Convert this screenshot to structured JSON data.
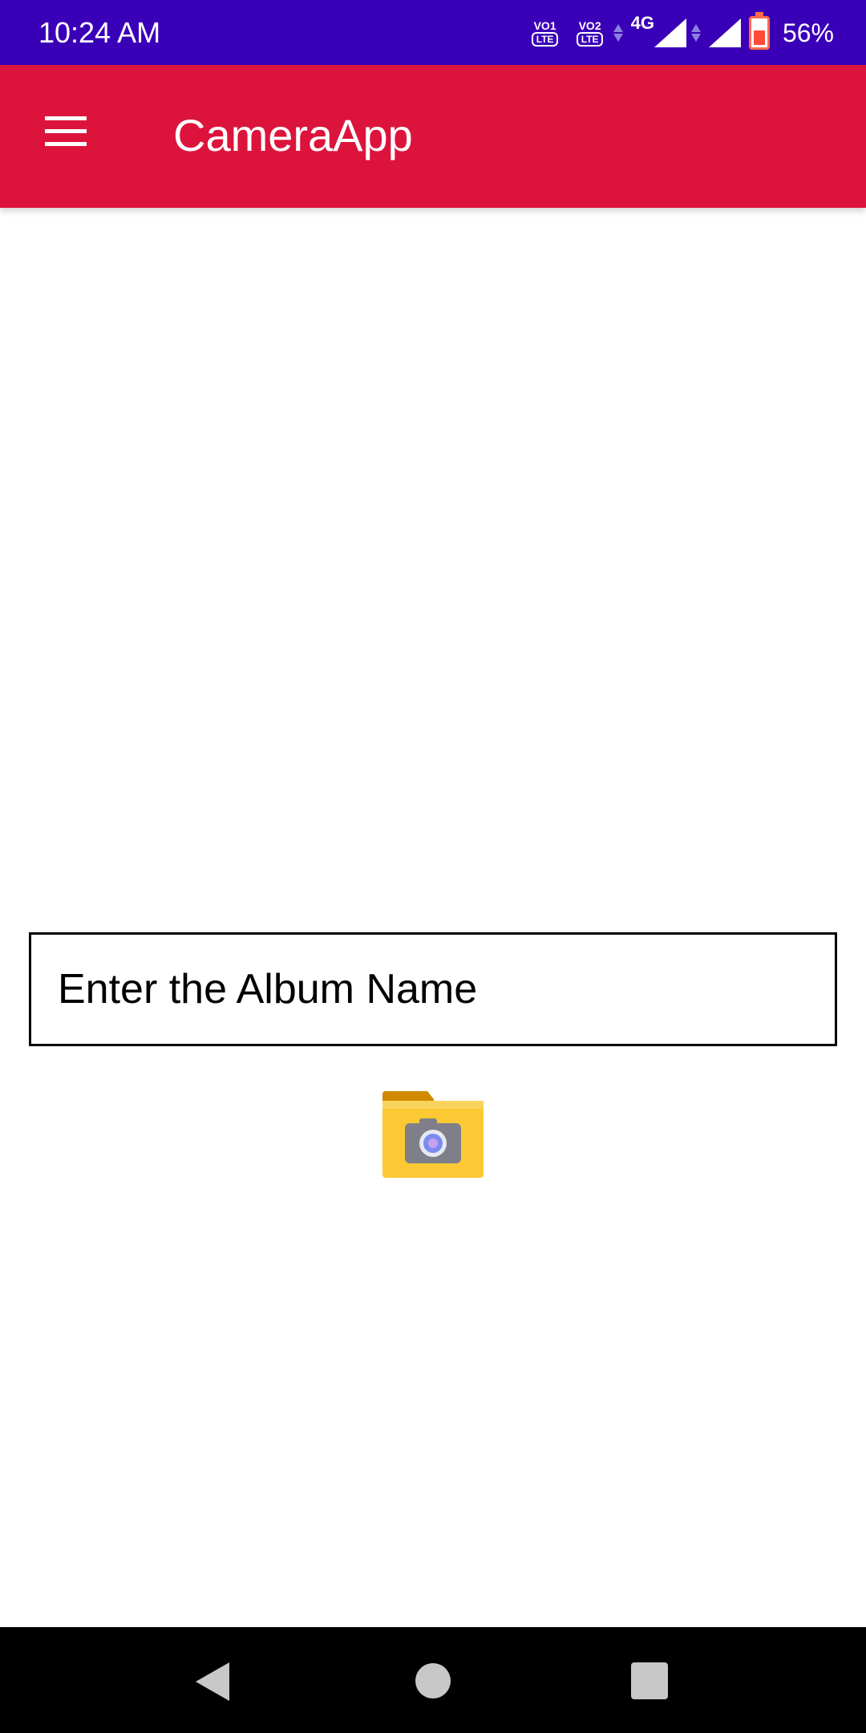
{
  "status_bar": {
    "time": "10:24 AM",
    "sim1_label": "VO",
    "sim1_num": "1",
    "sim2_label": "VO",
    "sim2_num": "2",
    "lte_label": "LTE",
    "network_type": "4G",
    "battery_percent": "56%",
    "background_color": "#3a00b8"
  },
  "app_bar": {
    "title": "CameraApp",
    "menu_icon": "hamburger-menu-icon",
    "background_color": "#dc143c"
  },
  "album_form": {
    "album_name_placeholder": "Enter the Album Name",
    "album_name_value": "",
    "camera_folder_icon": "camera-folder-icon"
  },
  "nav_bar": {
    "back_icon": "back-triangle-icon",
    "home_icon": "home-circle-icon",
    "recents_icon": "recents-square-icon"
  }
}
